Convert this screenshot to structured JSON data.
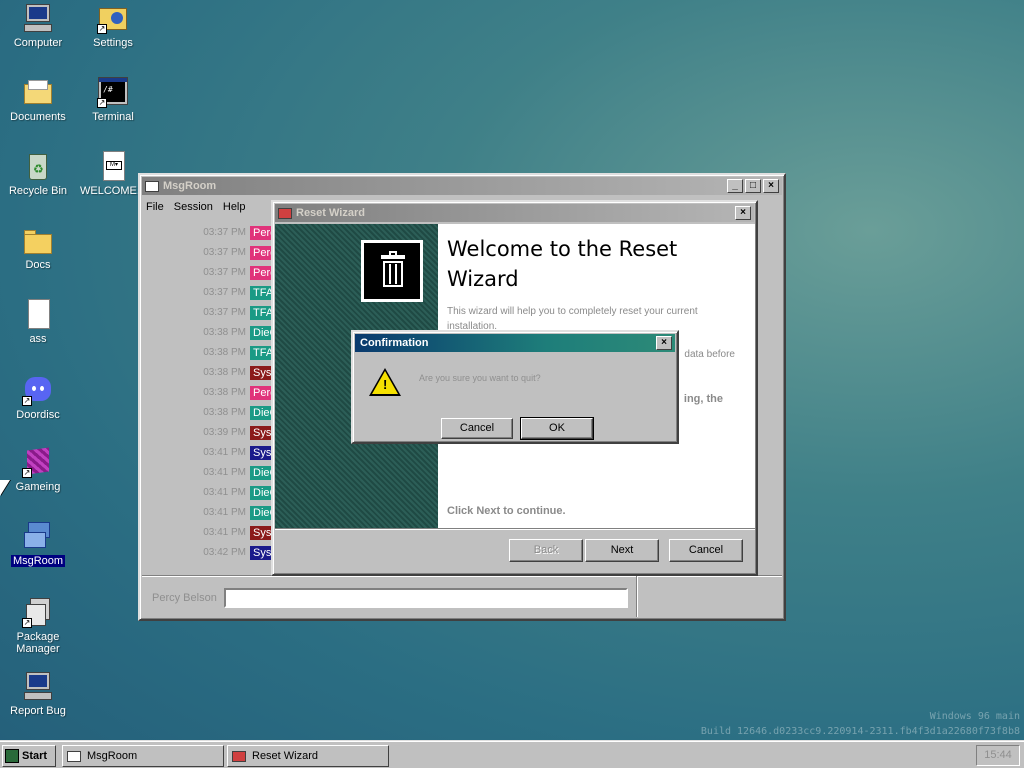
{
  "desktop": {
    "icons": [
      {
        "label": "Computer"
      },
      {
        "label": "Settings"
      },
      {
        "label": "Documents"
      },
      {
        "label": "Terminal"
      },
      {
        "label": "Recycle Bin"
      },
      {
        "label": "WELCOME..."
      },
      {
        "label": "Docs"
      },
      {
        "label": "ass"
      },
      {
        "label": "Doordisc"
      },
      {
        "label": "Gameing"
      },
      {
        "label": "MsgRoom"
      },
      {
        "label": "Package Manager"
      },
      {
        "label": "Report Bug"
      }
    ],
    "build_line1": "Windows 96 main",
    "build_line2": "Build 12646.d0233cc9.220914-2311.fb4f3d1a22680f73f8b8"
  },
  "msgroom": {
    "title": "MsgRoom",
    "menu": [
      "File",
      "Session",
      "Help"
    ],
    "messages": [
      {
        "time": "03:37 PM",
        "user": "Percy Be",
        "color": "#e0337a"
      },
      {
        "time": "03:37 PM",
        "user": "Percy Be",
        "color": "#e0337a"
      },
      {
        "time": "03:37 PM",
        "user": "Percy Be",
        "color": "#e0337a"
      },
      {
        "time": "03:37 PM",
        "user": "TFAHD-",
        "color": "#1a9a85"
      },
      {
        "time": "03:37 PM",
        "user": "TFAHD-",
        "color": "#1a9a85"
      },
      {
        "time": "03:38 PM",
        "user": "DieGPro",
        "color": "#1a9a85"
      },
      {
        "time": "03:38 PM",
        "user": "TFAHD-",
        "color": "#1a9a85"
      },
      {
        "time": "03:38 PM",
        "user": "Sys",
        "color": "#8b1a1a"
      },
      {
        "time": "03:38 PM",
        "user": "Percy Be",
        "color": "#e0337a"
      },
      {
        "time": "03:38 PM",
        "user": "DieGPro",
        "color": "#1a9a85"
      },
      {
        "time": "03:39 PM",
        "user": "Sys",
        "color": "#8b1a1a"
      },
      {
        "time": "03:41 PM",
        "user": "Sys",
        "color": "#1a1a8b"
      },
      {
        "time": "03:41 PM",
        "user": "DieGPro",
        "color": "#1a9a85"
      },
      {
        "time": "03:41 PM",
        "user": "DieGPro",
        "color": "#1a9a85"
      },
      {
        "time": "03:41 PM",
        "user": "DieGPro",
        "color": "#1a9a85"
      },
      {
        "time": "03:41 PM",
        "user": "Sys",
        "color": "#8b1a1a"
      },
      {
        "time": "03:42 PM",
        "user": "Sys",
        "color": "#1a1a8b"
      }
    ],
    "nickname": "Percy Belson",
    "input_value": ""
  },
  "wizard": {
    "title": "Reset Wizard",
    "heading": "Welcome to the Reset Wizard",
    "intro": "This wizard will help you to completely reset your current installation.",
    "partial_line": "data before",
    "partial_bold": "ing, the",
    "footer": "Click Next to continue.",
    "back_label": "Back",
    "next_label": "Next",
    "cancel_label": "Cancel"
  },
  "confirm": {
    "title": "Confirmation",
    "message": "Are you sure you want to quit?",
    "cancel_label": "Cancel",
    "ok_label": "OK"
  },
  "taskbar": {
    "start_label": "Start",
    "tasks": [
      {
        "label": "MsgRoom"
      },
      {
        "label": "Reset Wizard"
      }
    ],
    "clock": "15:44"
  }
}
